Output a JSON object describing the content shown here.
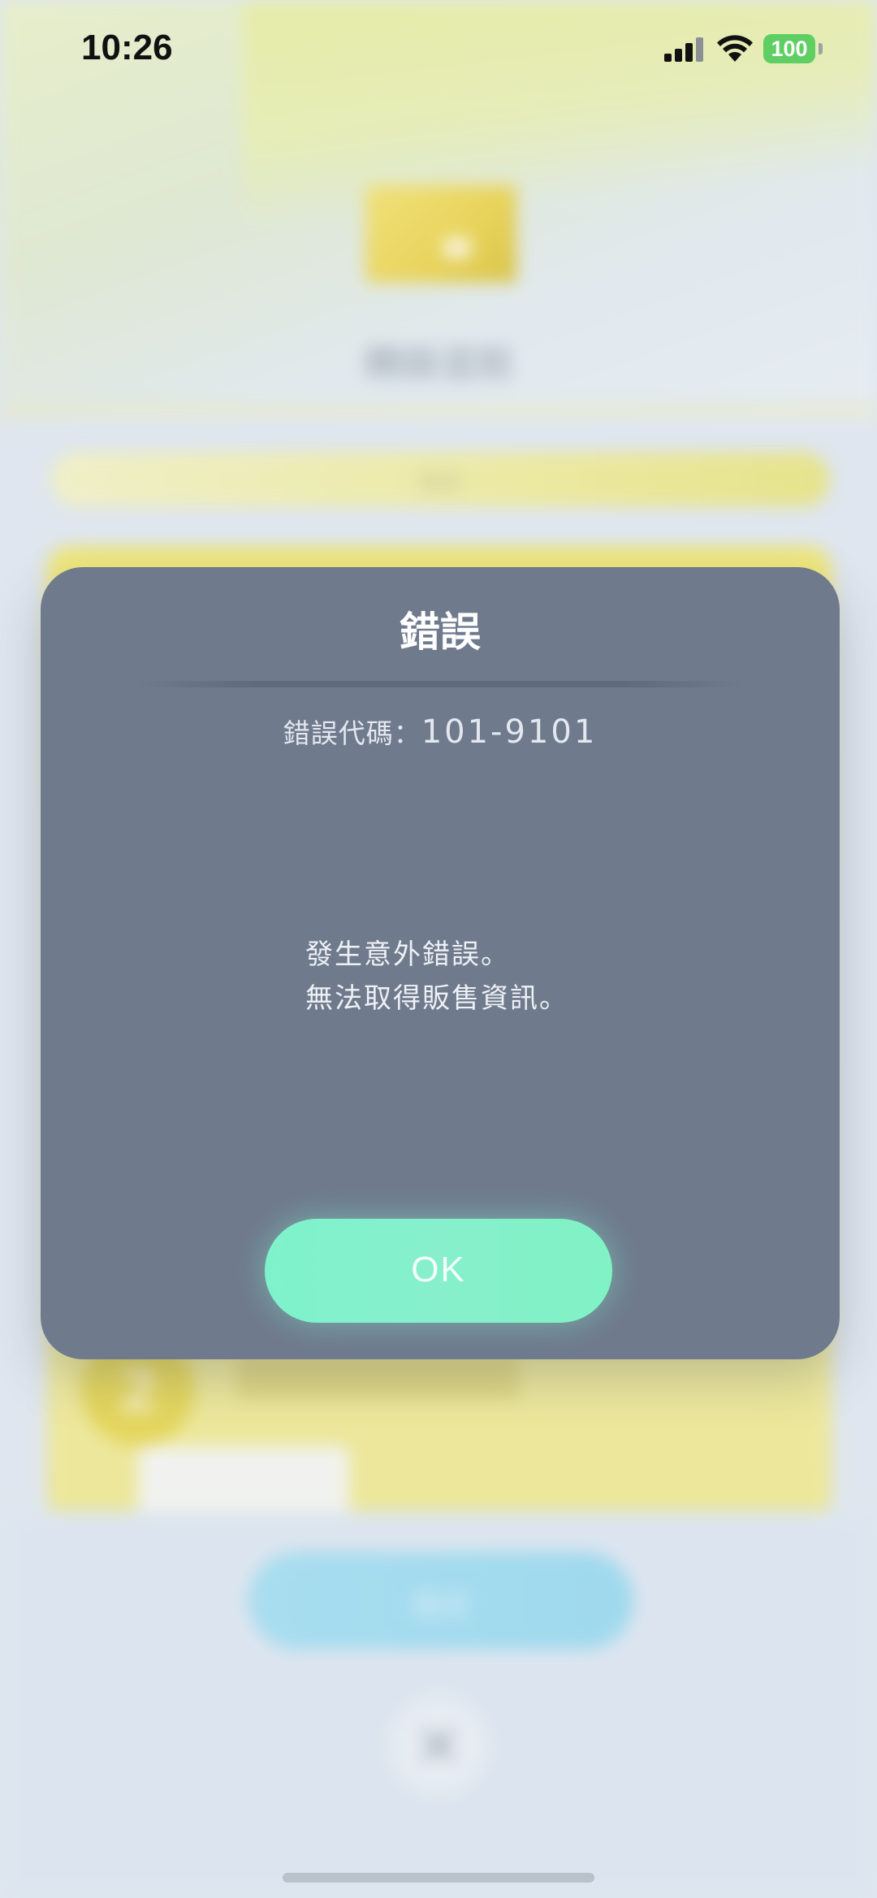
{
  "status_bar": {
    "time": "10:26",
    "battery": "100",
    "battery_color": "#5fcf63"
  },
  "background": {
    "title": "轉錄道館",
    "pill_label": "簡易",
    "step_number": "2",
    "primary_button": "購買"
  },
  "dialog": {
    "title": "錯誤",
    "error_code_label": "錯誤代碼：",
    "error_code": "101-9101",
    "message_line1": "發生意外錯誤。",
    "message_line2": "無法取得販售資訊。",
    "ok_label": "OK",
    "background_color": "#6f7a8d",
    "ok_color": "#7ef3cb"
  },
  "icons": {
    "signal": "cellular-signal-icon",
    "wifi": "wifi-icon",
    "battery": "battery-icon",
    "close": "close-icon"
  }
}
